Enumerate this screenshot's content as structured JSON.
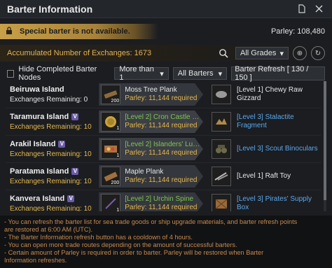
{
  "window": {
    "title": "Barter Information"
  },
  "notice": {
    "text": "Special barter is not available.",
    "parley": "Parley: 108,480"
  },
  "accumulated": {
    "text": "Accumulated Number of Exchanges: 1673"
  },
  "grade_select": {
    "value": "All Grades"
  },
  "filters": {
    "hide_label": "Hide Completed Barter Nodes",
    "count_select": "More than 1",
    "barter_select": "All Barters",
    "refresh": "Barter Refresh [ 130 / 150 ]"
  },
  "rows": [
    {
      "island": "Beiruwa Island",
      "badge": "",
      "remaining": "Exchanges Remaining: 0",
      "give_qty": "200",
      "give_name": "Moss Tree Plank",
      "give_req": "Parley: 11,144 required",
      "get_qty": "1",
      "get_name": "[Level 1] Chewy Raw Gizzard"
    },
    {
      "island": "Taramura Island",
      "badge": "V",
      "remaining": "Exchanges Remaining: 10",
      "give_qty": "1",
      "give_name": "[Level 2] Cron Castle …",
      "give_req": "Parley: 11,144 required",
      "get_qty": "1",
      "get_name": "[Level 3] Stalactite Fragment"
    },
    {
      "island": "Arakil Island",
      "badge": "V",
      "remaining": "Exchanges Remaining: 10",
      "give_qty": "1",
      "give_name": "[Level 2] Islanders' Lu…",
      "give_req": "Parley: 11,144 required",
      "get_qty": "1",
      "get_name": "[Level 3] Scout Binoculars"
    },
    {
      "island": "Paratama Island",
      "badge": "V",
      "remaining": "Exchanges Remaining: 10",
      "give_qty": "200",
      "give_name": "Maple Plank",
      "give_req": "Parley: 11,144 required",
      "get_qty": "1",
      "get_name": "[Level 1] Raft Toy"
    },
    {
      "island": "Kanvera Island",
      "badge": "V",
      "remaining": "Exchanges Remaining: 10",
      "give_qty": "1",
      "give_name": "[Level 2] Urchin Spine",
      "give_req": "Parley: 11,144 required",
      "get_qty": "1",
      "get_name": "[Level 3] Pirates' Supply Box"
    }
  ],
  "info": [
    "- You can refresh the barter list for sea trade goods or ship upgrade materials, and barter refresh points",
    "are restored at 6:00 AM (UTC).",
    "- The Barter Information refresh button has a cooldown of 4 hours.",
    "- You can open more trade routes depending on the amount of successful barters.",
    "- Certain amount of Parley is required in order to barter. Parley will be restored when Barter",
    "Information refreshes."
  ]
}
